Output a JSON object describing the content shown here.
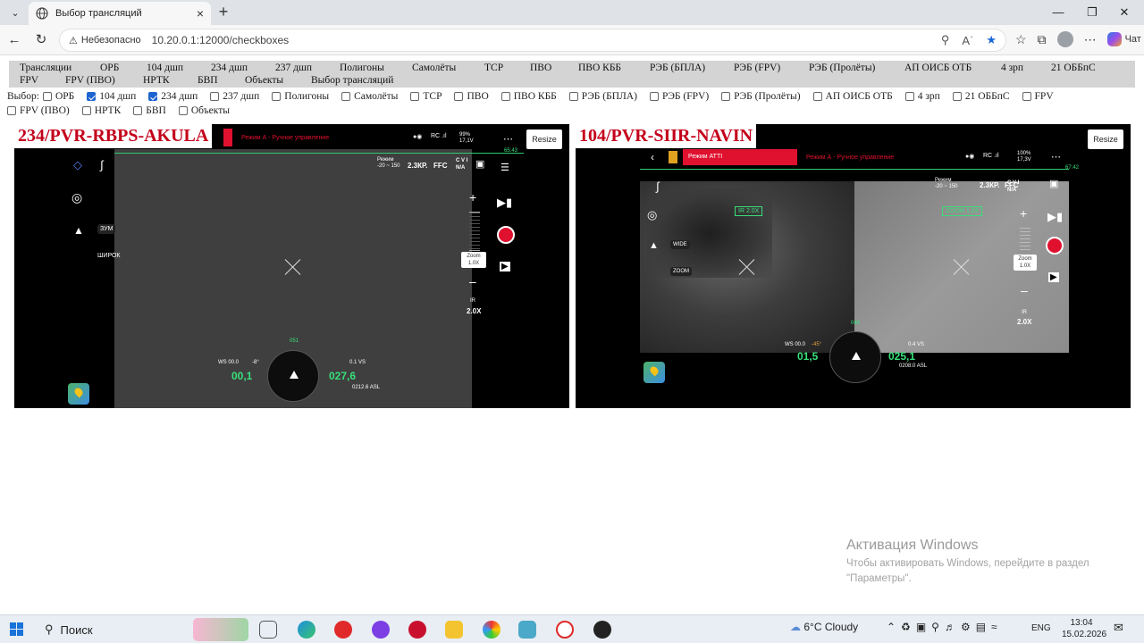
{
  "browser": {
    "tab_title": "Выбор трансляций",
    "insecure_label": "Небезопасно",
    "url": "10.20.0.1:12000/checkboxes",
    "copilot_label": "Чат"
  },
  "menu": [
    "Трансляции",
    "ОРБ",
    "104 дшп",
    "234 дшп",
    "237 дшп",
    "Полигоны",
    "Самолёты",
    "ТСР",
    "ПВО",
    "ПВО КББ",
    "РЭБ (БПЛА)",
    "РЭБ (FPV)",
    "РЭБ (Пролёты)",
    "АП ОИСБ ОТБ",
    "4 зрп",
    "21 ОББпС",
    "FPV",
    "FPV (ПВО)",
    "НРТК",
    "БВП",
    "Объекты",
    "Выбор трансляций"
  ],
  "selector": {
    "label": "Выбор:",
    "items": [
      {
        "label": "ОРБ",
        "checked": false
      },
      {
        "label": "104 дшп",
        "checked": true
      },
      {
        "label": "234 дшп",
        "checked": true
      },
      {
        "label": "237 дшп",
        "checked": false
      },
      {
        "label": "Полигоны",
        "checked": false
      },
      {
        "label": "Самолёты",
        "checked": false
      },
      {
        "label": "ТСР",
        "checked": false
      },
      {
        "label": "ПВО",
        "checked": false
      },
      {
        "label": "ПВО КББ",
        "checked": false
      },
      {
        "label": "РЭБ (БПЛА)",
        "checked": false
      },
      {
        "label": "РЭБ (FPV)",
        "checked": false
      },
      {
        "label": "РЭБ (Пролёты)",
        "checked": false
      },
      {
        "label": "АП ОИСБ ОТБ",
        "checked": false
      },
      {
        "label": "4 зрп",
        "checked": false
      },
      {
        "label": "21 ОББпС",
        "checked": false
      },
      {
        "label": "FPV",
        "checked": false
      },
      {
        "label": "FPV (ПВО)",
        "checked": false
      },
      {
        "label": "НРТК",
        "checked": false
      },
      {
        "label": "БВП",
        "checked": false
      },
      {
        "label": "Объекты",
        "checked": false
      }
    ]
  },
  "streams": [
    {
      "title": "234/PVR-RBPS-AKULA",
      "resize": "Resize",
      "mode": "Режим А - Ручное управление",
      "time": "65:43",
      "rc": "RC",
      "battery": "99%",
      "voltage": "17,1V",
      "regime": "Режим",
      "range": "-20 ~ 150",
      "zoom_mode": "2.3КР.",
      "ffc": "FFC",
      "cvi": "C V I",
      "na": "N/A",
      "zoom_btn": "ЗУМ",
      "wide_btn": "ШИРОК",
      "zoom_label": "Zoom",
      "zoom_value": "1.0X",
      "ir_label": "IR",
      "ir_value": "2.0X",
      "ws": "WS 00.0",
      "angle": "-8°",
      "speed": "00,1",
      "vs": "0.1 VS",
      "alt": "027,6",
      "asl": "0212.6 ASL",
      "heading": "051"
    },
    {
      "title": "104/PVR-SIIR-NAVIN",
      "resize": "Resize",
      "mode_atti": "Режим ATTI",
      "mode": "Режим А - Ручное управление",
      "time": "67:42",
      "rc": "RC",
      "battery": "100%",
      "voltage": "17,3V",
      "regime": "Режим",
      "range": "-20 ~ 150",
      "zoom_mode": "2.3КР.",
      "ffc": "FFC",
      "cvi": "C V I",
      "na": "N/A",
      "wide_btn": "WIDE",
      "zoom_btn": "ZOOM",
      "ir_tag": "IR 2.0X",
      "zoom_tag": "ZOOM 1.0X",
      "zoom_label": "Zoom",
      "zoom_value": "1.0X",
      "ir_label": "IR",
      "ir_value": "2.0X",
      "ws": "WS 00.0",
      "angle": "-45°",
      "speed": "01,5",
      "vs": "0.4 VS",
      "alt": "025,1",
      "asl": "0208.0 ASL",
      "heading": "048"
    }
  ],
  "watermark": {
    "title": "Активация Windows",
    "text": "Чтобы активировать Windows, перейдите в раздел \"Параметры\"."
  },
  "taskbar": {
    "search": "Поиск",
    "weather": "6°C  Cloudy",
    "lang": "ENG",
    "time": "13:04",
    "date": "15.02.2026"
  }
}
